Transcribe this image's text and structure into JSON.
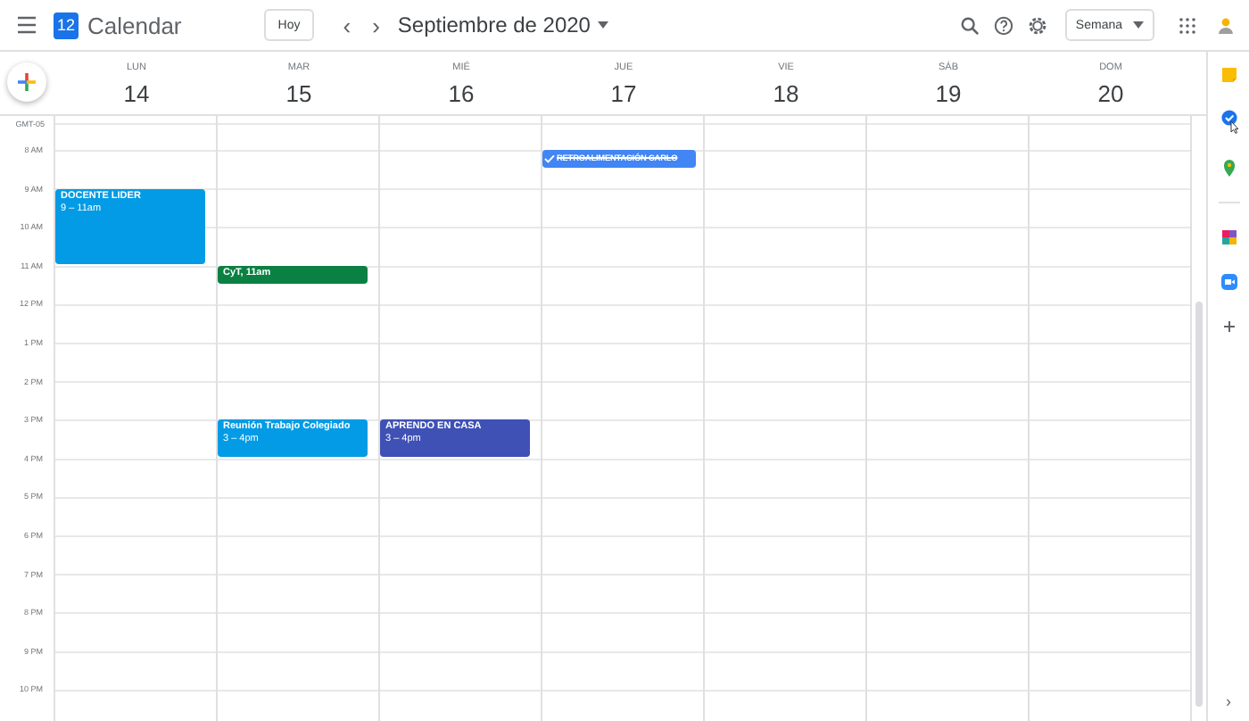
{
  "header": {
    "app_name": "Calendar",
    "logo_day": "12",
    "today_button": "Hoy",
    "prev": "‹",
    "next": "›",
    "period_title": "Septiembre de 2020",
    "view_selector": "Semana"
  },
  "timezone": "GMT-05",
  "days": [
    {
      "name": "LUN",
      "number": "14"
    },
    {
      "name": "MAR",
      "number": "15"
    },
    {
      "name": "MIÉ",
      "number": "16"
    },
    {
      "name": "JUE",
      "number": "17"
    },
    {
      "name": "VIE",
      "number": "18"
    },
    {
      "name": "SÁB",
      "number": "19"
    },
    {
      "name": "DOM",
      "number": "20"
    }
  ],
  "time_labels": [
    "8 AM",
    "9 AM",
    "10 AM",
    "11 AM",
    "12 PM",
    "1 PM",
    "2 PM",
    "3 PM",
    "4 PM",
    "5 PM",
    "6 PM",
    "7 PM",
    "8 PM",
    "9 PM",
    "10 PM"
  ],
  "events": [
    {
      "kind": "event",
      "title": "DOCENTE LIDER",
      "time": "9 – 11am",
      "color": "#039be5"
    },
    {
      "kind": "event",
      "title": "CyT, 11am",
      "color": "#0b8043"
    },
    {
      "kind": "event",
      "title": "Reunión Trabajo Colegiado",
      "time": "3 – 4pm",
      "color": "#039be5"
    },
    {
      "kind": "event",
      "title": "APRENDO EN CASA",
      "time": "3 – 4pm",
      "color": "#3f51b5"
    },
    {
      "kind": "task",
      "title": "RETROALIMENTACIÓN CARLO",
      "done": true,
      "color": "#4285f4"
    }
  ],
  "side_panel": {
    "expand": "›"
  }
}
